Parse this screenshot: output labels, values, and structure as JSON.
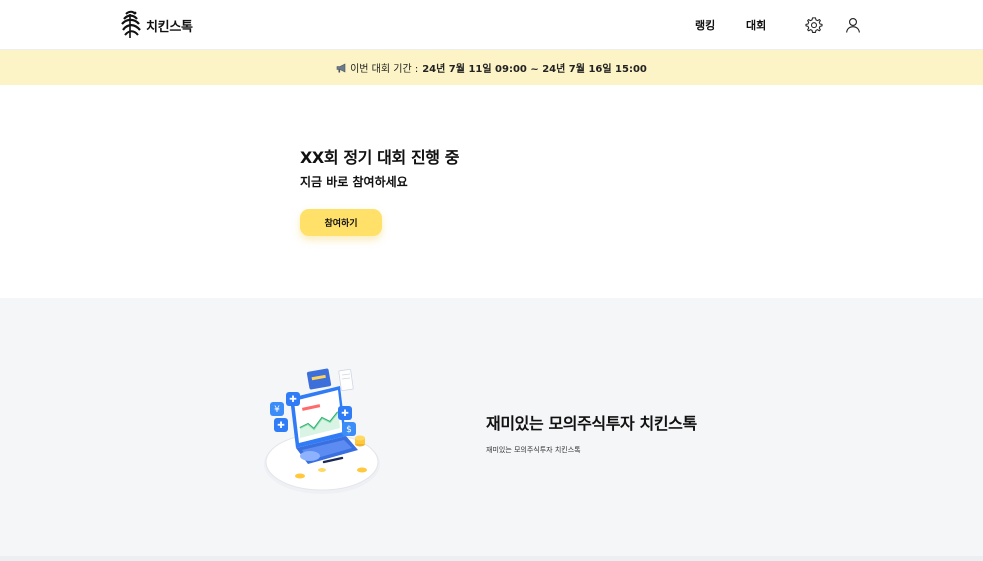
{
  "header": {
    "logo_text": "치킨스톡",
    "nav": {
      "ranking": "랭킹",
      "contest": "대회"
    },
    "icons": {
      "settings": "gear-icon",
      "profile": "user-icon"
    }
  },
  "banner": {
    "icon": "megaphone-icon",
    "label": "이번 대회 기간 :",
    "period": "24년 7월 11일 09:00 ~ 24년 7월 16일 15:00"
  },
  "hero": {
    "title": "XX회 정기 대회 진행 중",
    "subtitle": "지금 바로 참여하세요",
    "cta": "참여하기"
  },
  "feature": {
    "title": "재미있는 모의주식투자 치킨스톡",
    "description": "재미있는 모의주식투자 치킨스톡"
  },
  "colors": {
    "accent": "#ffe16a",
    "banner_bg": "#fcf4c6",
    "section_bg": "#f5f6f8",
    "illustration_blue": "#2f7cf6"
  }
}
